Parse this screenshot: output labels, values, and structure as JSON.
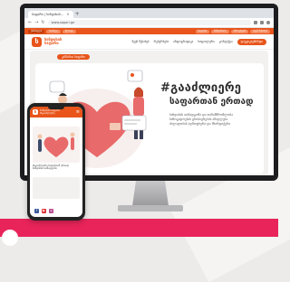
{
  "browser": {
    "tab_title": "საფარი | სინდისის...",
    "url": "www.sapari.ge"
  },
  "topbar": {
    "items": [
      "ქართული",
      "სიახლე",
      "ბლოგი",
      "საფარი",
      "მიმდინარე",
      "პროექტები",
      "ჩვენ შესახებ"
    ]
  },
  "site": {
    "logo_text_line1": "სინდისის",
    "logo_text_line2": "საფარი",
    "menu": [
      "ჩვენ შესახებ",
      "რესურსები",
      "ინფოგრაფიკა",
      "სოციალური",
      "კონტაქტი"
    ],
    "cta": "დაგვიკავშირდი"
  },
  "content": {
    "category_chip": "კამპანია საფარი",
    "title_line1": "#გააძლიერე",
    "title_line2": "საფართან ერთად",
    "desc_lines": [
      "სინდისის თანადგომა და თანამშრომლობა",
      "საზოგადოების ცნობიერების ამაღლება",
      "ძალადობის აღმოფხვრა და მხარდაჭერა"
    ]
  },
  "phone": {
    "head_line1": "სინდისის საფარი",
    "head_line2": "#გააძლიერე",
    "title_lines": [
      "#გააძლიერე საფართან ერთად",
      "სინდისის თანადგომა"
    ]
  },
  "colors": {
    "accent": "#e8541a",
    "pink": "#e8245a",
    "heart": "#e96a6a"
  }
}
